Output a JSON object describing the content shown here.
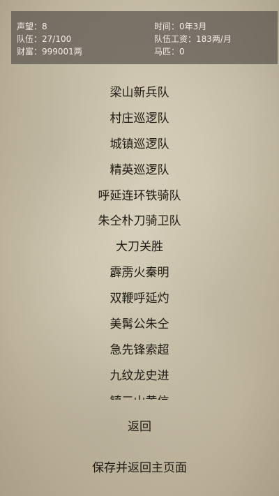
{
  "status": {
    "reputation": "声望：8",
    "time": "时间：0年3月",
    "troops": "队伍：27/100",
    "wage": "队伍工资：183两/月",
    "wealth": "财富：999001两",
    "horses": "马匹：0"
  },
  "menu": {
    "items": [
      "梁山新兵队",
      "村庄巡逻队",
      "城镇巡逻队",
      "精英巡逻队",
      "呼延连环铁骑队",
      "朱仝朴刀骑卫队",
      "大刀关胜",
      "霹雳火秦明",
      "双鞭呼延灼",
      "美髯公朱仝",
      "急先锋索超",
      "九纹龙史进",
      "镇三山黄信"
    ]
  },
  "buttons": {
    "back": "返回",
    "save_return": "保存并返回主页面"
  }
}
